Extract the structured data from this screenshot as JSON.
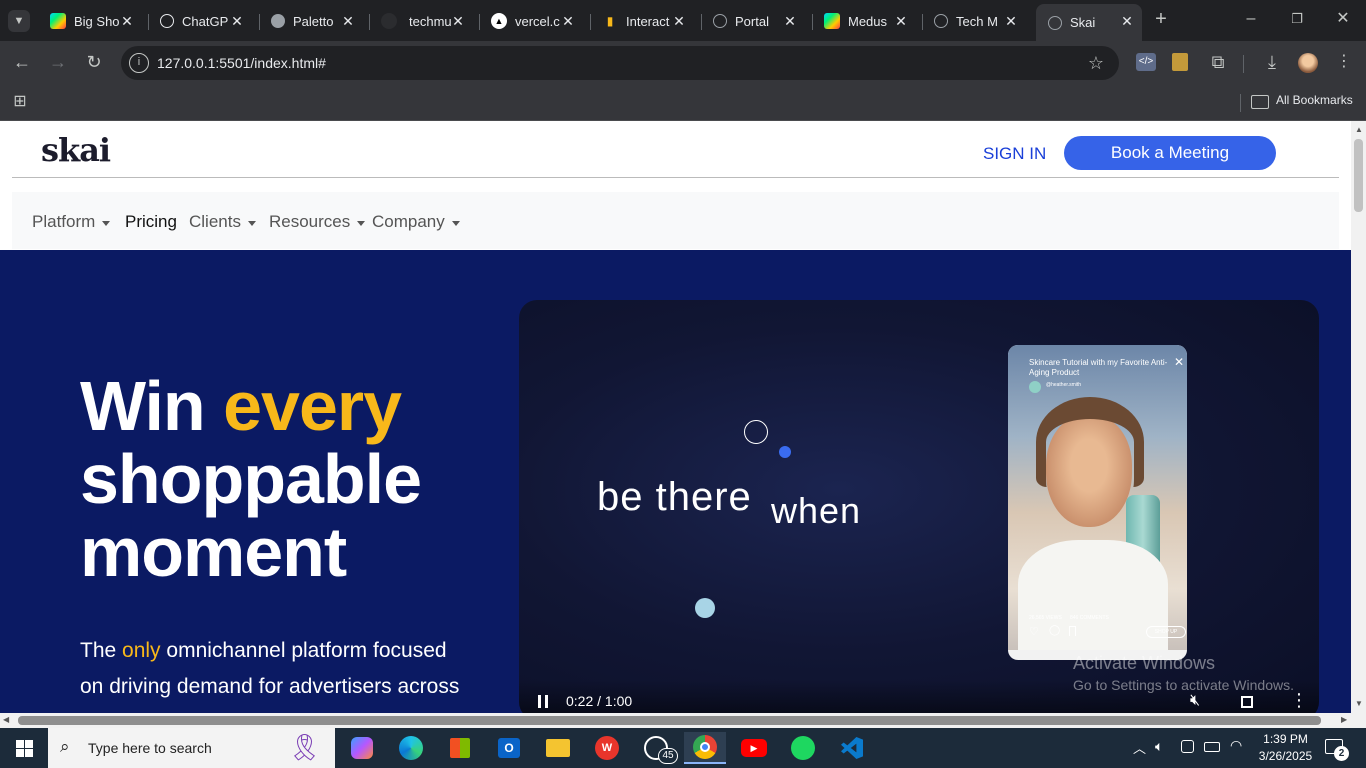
{
  "browser": {
    "tabs": [
      {
        "label": "Big Sho",
        "icon": "google-play-icon"
      },
      {
        "label": "ChatGP",
        "icon": "chatgpt-icon"
      },
      {
        "label": "Paletto",
        "icon": "palette-icon"
      },
      {
        "label": "techmu",
        "icon": "github-icon"
      },
      {
        "label": "vercel.c",
        "icon": "vercel-icon"
      },
      {
        "label": "Interact",
        "icon": "interact-icon"
      },
      {
        "label": "Portal",
        "icon": "globe-icon"
      },
      {
        "label": "Medus",
        "icon": "google-play-icon"
      },
      {
        "label": "Tech M",
        "icon": "globe-icon"
      },
      {
        "label": "Skai",
        "icon": "globe-icon"
      }
    ],
    "url": "127.0.0.1:5501/index.html#",
    "bookmarks_label": "All Bookmarks"
  },
  "site": {
    "logo": "skai",
    "sign_in": "SIGN IN",
    "book_meeting": "Book a Meeting",
    "nav": {
      "platform": "Platform",
      "pricing": "Pricing",
      "clients": "Clients",
      "resources": "Resources",
      "company": "Company"
    },
    "hero": {
      "line1_a": "Win",
      "line1_b": "every",
      "line2": "shoppable",
      "line3": "moment",
      "sub_a": "The",
      "sub_highlight": "only",
      "sub_b": "omnichannel platform focused",
      "sub_line2": "on driving demand for advertisers across"
    },
    "video": {
      "text_a": "be there",
      "text_b": "when",
      "time": "0:22 / 1:00",
      "phone_title": "Skincare Tutorial with my Favorite Anti-Aging Product",
      "phone_handle": "@heather.smith",
      "phone_views": "26,565 VIEWS",
      "phone_comments": "846 COMMENTS",
      "phone_cta": "SHOP UP"
    },
    "watermark": {
      "title": "Activate Windows",
      "subtitle": "Go to Settings to activate Windows."
    }
  },
  "taskbar": {
    "search_placeholder": "Type here to search",
    "whatsapp_badge": "45",
    "time": "1:39 PM",
    "date": "3/26/2025",
    "notif_count": "2"
  },
  "colors": {
    "hero_bg": "#0b1a63",
    "accent_yellow": "#f8b81a",
    "button_blue": "#3663e8",
    "signin_blue": "#1a3fd8"
  }
}
